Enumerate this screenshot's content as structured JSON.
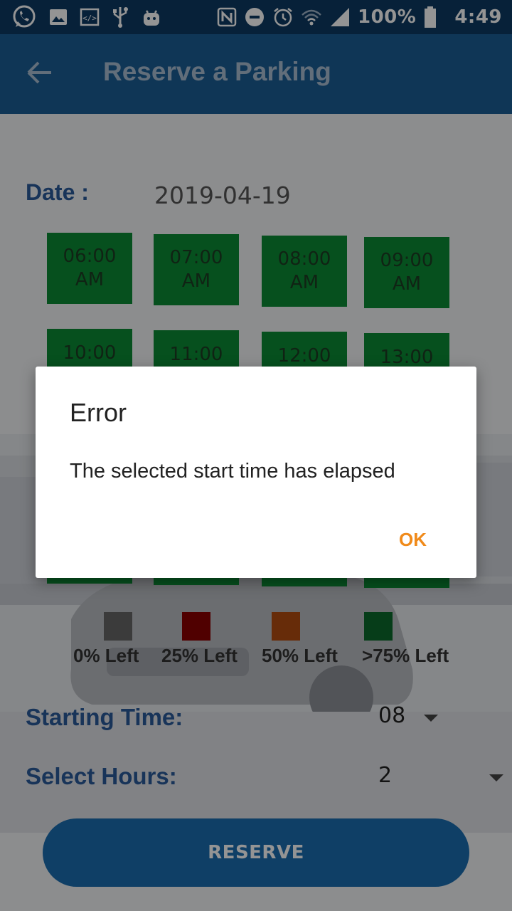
{
  "status_bar": {
    "battery": "100%",
    "time": "4:49",
    "icons_left": [
      "whatsapp-icon",
      "image-icon",
      "code-icon",
      "usb-icon",
      "android-icon"
    ],
    "icons_right": [
      "nfc-icon",
      "dnd-icon",
      "alarm-icon",
      "wifi-icon",
      "signal-icon",
      "battery-icon"
    ]
  },
  "app_bar": {
    "title": "Reserve a Parking",
    "back_icon": "back-arrow-icon"
  },
  "form": {
    "date_label": "Date :",
    "date_value": "2019-04-19",
    "starting_time_label": "Starting Time:",
    "starting_time_value": "08",
    "select_hours_label": "Select Hours:",
    "select_hours_value": "2",
    "reserve_label": "RESERVE"
  },
  "slots": [
    {
      "time": "06:00",
      "ampm": "AM"
    },
    {
      "time": "07:00",
      "ampm": "AM"
    },
    {
      "time": "08:00",
      "ampm": "AM"
    },
    {
      "time": "09:00",
      "ampm": "AM"
    },
    {
      "time": "10:00"
    },
    {
      "time": "11:00"
    },
    {
      "time": "12:00"
    },
    {
      "time": "13:00"
    }
  ],
  "legend": [
    {
      "label": "0% Left",
      "color": "#666666"
    },
    {
      "label": "25% Left",
      "color": "#8a0000"
    },
    {
      "label": "50% Left",
      "color": "#b24d10"
    },
    {
      "label": ">75% Left",
      "color": "#0b6a2c"
    }
  ],
  "colors": {
    "status_bar": "#0d3a63",
    "app_bar": "#1b5d95",
    "slot_green": "#0b8a34",
    "accent_ok": "#f08a1a",
    "reserve_button": "#1b6db0"
  },
  "dialog": {
    "title": "Error",
    "message": "The selected start time has elapsed",
    "ok_label": "OK"
  }
}
